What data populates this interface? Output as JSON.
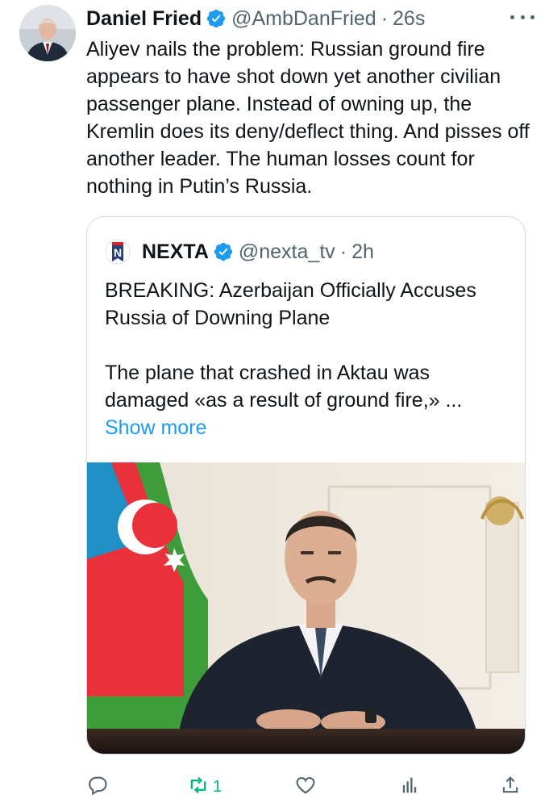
{
  "tweet": {
    "author_name": "Daniel Fried",
    "handle": "@AmbDanFried",
    "separator": "·",
    "time": "26s",
    "text": "Aliyev nails the problem: Russian ground fire appears to have shot down yet another civilian passenger plane. Instead of owning up, the Kremlin does its deny/deflect thing. And pisses off another leader. The human losses count for nothing in Putin’s Russia.",
    "more_icon": "more-dots-icon"
  },
  "quote": {
    "author_name": "NEXTA",
    "handle": "@nexta_tv",
    "separator": "·",
    "time": "2h",
    "headline": "BREAKING: Azerbaijan Officially Accuses Russia of Downing Plane",
    "body": "The plane that crashed in Aktau was damaged «as a result of ground fire,» ...",
    "show_more": "Show more",
    "avatar_letter": "N"
  },
  "actions": {
    "reply_icon": "reply-icon",
    "retweet_icon": "retweet-icon",
    "retweet_count": "1",
    "like_icon": "heart-icon",
    "views_icon": "views-icon",
    "share_icon": "share-icon"
  },
  "colors": {
    "text": "#0f1419",
    "secondary": "#536471",
    "link": "#1d9bf0",
    "retweet": "#00ba7c",
    "verified": "#1d9bf0",
    "border": "#cfd9de"
  }
}
